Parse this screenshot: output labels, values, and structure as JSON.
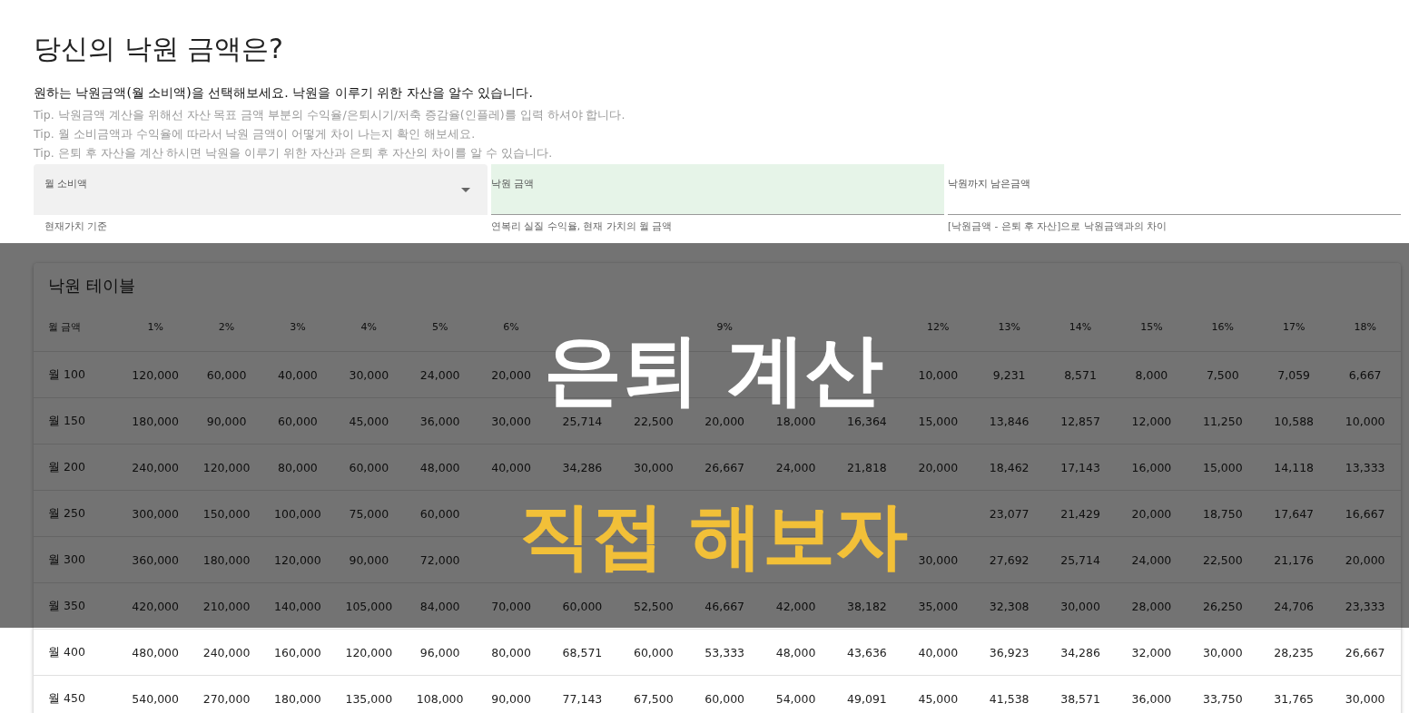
{
  "page_title": "당신의 낙원 금액은?",
  "intro": "원하는 낙원금액(월 소비액)을 선택해보세요. 낙원을 이루기 위한 자산을 알수 있습니다.",
  "tips": [
    "Tip. 낙원금액 계산을 위해선 자산 목표 금액 부분의 수익율/은퇴시기/저축 증감율(인플레)를 입력 하셔야 합니다.",
    "Tip. 월 소비금액과 수익율에 따라서 낙원 금액이 어떻게 차이 나는지 확인 해보세요.",
    "Tip. 은퇴 후 자산을 계산 하시면 낙원을 이루기 위한 자산과 은퇴 후 자산의 차이를 알 수 있습니다."
  ],
  "fields": [
    {
      "kind": "select",
      "label": "월 소비액",
      "helper": "현재가치 기준"
    },
    {
      "kind": "output",
      "label": "낙원 금액",
      "helper": "연복리 실질 수익율, 현재 가치의 월 금액",
      "highlighted": true
    },
    {
      "kind": "output",
      "label": "낙원까지 남은금액",
      "helper": "[낙원금액 - 은퇴 후 자산]으로 낙원금액과의 차이",
      "highlighted": false
    }
  ],
  "table": {
    "title": "낙원 테이블",
    "columns": [
      "월 금액",
      "1%",
      "2%",
      "3%",
      "4%",
      "5%",
      "6%",
      null,
      null,
      "9%",
      null,
      null,
      "12%",
      "13%",
      "14%",
      "15%",
      "16%",
      "17%",
      "18%"
    ],
    "rows": [
      [
        "월 100",
        "120,000",
        "60,000",
        "40,000",
        "30,000",
        "24,000",
        "20,000",
        null,
        null,
        null,
        null,
        null,
        "10,000",
        "9,231",
        "8,571",
        "8,000",
        "7,500",
        "7,059",
        "6,667"
      ],
      [
        "월 150",
        "180,000",
        "90,000",
        "60,000",
        "45,000",
        "36,000",
        "30,000",
        "25,714",
        "22,500",
        "20,000",
        "18,000",
        "16,364",
        "15,000",
        "13,846",
        "12,857",
        "12,000",
        "11,250",
        "10,588",
        "10,000"
      ],
      [
        "월 200",
        "240,000",
        "120,000",
        "80,000",
        "60,000",
        "48,000",
        "40,000",
        "34,286",
        "30,000",
        "26,667",
        "24,000",
        "21,818",
        "20,000",
        "18,462",
        "17,143",
        "16,000",
        "15,000",
        "14,118",
        "13,333"
      ],
      [
        "월 250",
        "300,000",
        "150,000",
        "100,000",
        "75,000",
        "60,000",
        null,
        null,
        null,
        null,
        null,
        null,
        null,
        "23,077",
        "21,429",
        "20,000",
        "18,750",
        "17,647",
        "16,667"
      ],
      [
        "월 300",
        "360,000",
        "180,000",
        "120,000",
        "90,000",
        "72,000",
        null,
        null,
        null,
        null,
        null,
        null,
        "30,000",
        "27,692",
        "25,714",
        "24,000",
        "22,500",
        "21,176",
        "20,000"
      ],
      [
        "월 350",
        "420,000",
        "210,000",
        "140,000",
        "105,000",
        "84,000",
        "70,000",
        "60,000",
        "52,500",
        "46,667",
        "42,000",
        "38,182",
        "35,000",
        "32,308",
        "30,000",
        "28,000",
        "26,250",
        "24,706",
        "23,333"
      ],
      [
        "월 400",
        "480,000",
        "240,000",
        "160,000",
        "120,000",
        "96,000",
        "80,000",
        "68,571",
        "60,000",
        "53,333",
        "48,000",
        "43,636",
        "40,000",
        "36,923",
        "34,286",
        "32,000",
        "30,000",
        "28,235",
        "26,667"
      ],
      [
        "월 450",
        "540,000",
        "270,000",
        "180,000",
        "135,000",
        "108,000",
        "90,000",
        "77,143",
        "67,500",
        "60,000",
        "54,000",
        "49,091",
        "45,000",
        "41,538",
        "38,571",
        "36,000",
        "33,750",
        "31,765",
        "30,000"
      ]
    ]
  },
  "overlay": {
    "title": "은퇴 계산",
    "subtitle": "직접 해보자"
  }
}
